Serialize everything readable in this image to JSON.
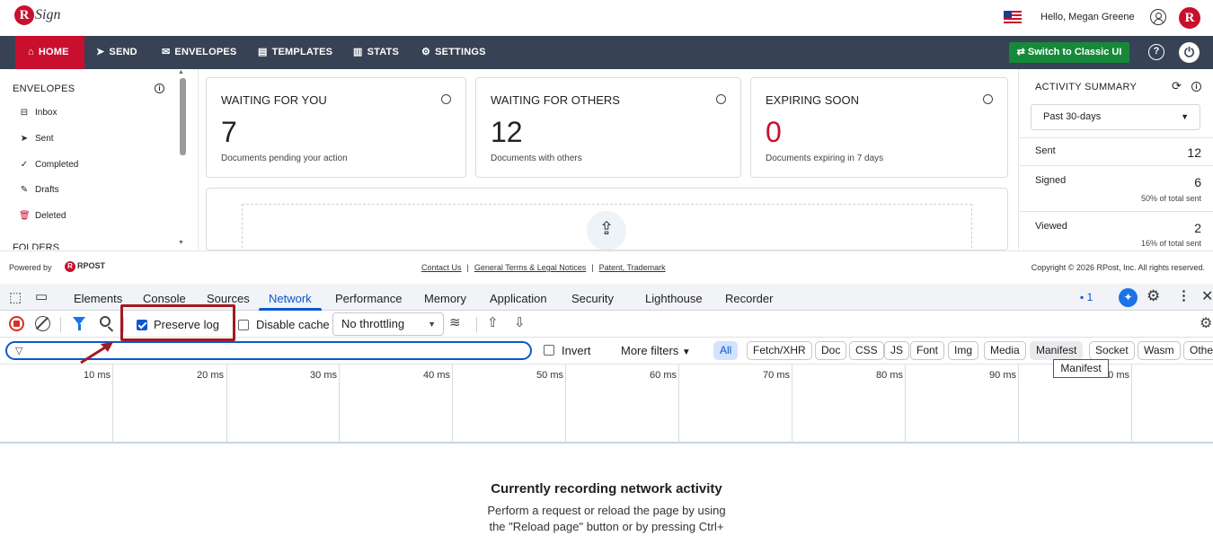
{
  "header": {
    "logo_letter": "R",
    "logo_text": "Sign",
    "greeting": "Hello, Megan Greene",
    "avatar_letter": "R"
  },
  "nav": {
    "items": [
      {
        "label": "HOME",
        "icon": "home-icon"
      },
      {
        "label": "SEND",
        "icon": "send-icon"
      },
      {
        "label": "ENVELOPES",
        "icon": "envelope-icon"
      },
      {
        "label": "TEMPLATES",
        "icon": "document-icon"
      },
      {
        "label": "STATS",
        "icon": "bar-chart-icon"
      },
      {
        "label": "SETTINGS",
        "icon": "gear-icon"
      }
    ],
    "classic_button": "Switch to Classic UI",
    "help": "?",
    "accent": "#c8102e",
    "bar_color": "#374355",
    "classic_color": "#17893a"
  },
  "sidebar": {
    "title": "ENVELOPES",
    "items": [
      {
        "label": "Inbox",
        "icon": "inbox-icon"
      },
      {
        "label": "Sent",
        "icon": "send-icon"
      },
      {
        "label": "Completed",
        "icon": "check-circle-icon"
      },
      {
        "label": "Drafts",
        "icon": "edit-icon"
      },
      {
        "label": "Deleted",
        "icon": "trash-icon"
      }
    ],
    "folders_title": "FOLDERS"
  },
  "cards": [
    {
      "title": "WAITING FOR YOU",
      "count": "7",
      "desc": "Documents pending your action"
    },
    {
      "title": "WAITING FOR OTHERS",
      "count": "12",
      "desc": "Documents with others"
    },
    {
      "title": "EXPIRING SOON",
      "count": "0",
      "desc": "Documents expiring in 7 days"
    }
  ],
  "activity": {
    "title": "ACTIVITY SUMMARY",
    "period": "Past 30-days",
    "stats": [
      {
        "label": "Sent",
        "value": "12",
        "pct": ""
      },
      {
        "label": "Signed",
        "value": "6",
        "pct": "50% of total sent"
      },
      {
        "label": "Viewed",
        "value": "2",
        "pct": "16% of total sent"
      }
    ]
  },
  "footer": {
    "powered": "Powered by",
    "brand": "RPOST",
    "links": [
      "Contact Us",
      "General Terms & Legal Notices",
      "Patent, Trademark"
    ],
    "separator": "|",
    "copyright": "Copyright © 2026 RPost, Inc. All rights reserved."
  },
  "devtools": {
    "tabs": [
      "Elements",
      "Console",
      "Sources",
      "Network",
      "Performance",
      "Memory",
      "Application",
      "Security",
      "Lighthouse",
      "Recorder"
    ],
    "active_tab": "Network",
    "message_count": "1",
    "preserve_log": "Preserve log",
    "disable_cache": "Disable cache",
    "throttling": "No throttling",
    "invert": "Invert",
    "more_filters": "More filters",
    "chips": [
      "All",
      "Fetch/XHR",
      "Doc",
      "CSS",
      "JS",
      "Font",
      "Img",
      "Media",
      "Manifest",
      "Socket",
      "Wasm",
      "Other"
    ],
    "tooltip": "Manifest",
    "timeline_labels": [
      "10 ms",
      "20 ms",
      "30 ms",
      "40 ms",
      "50 ms",
      "60 ms",
      "70 ms",
      "80 ms",
      "90 ms",
      "0 ms"
    ],
    "recording_title": "Currently recording network activity",
    "recording_line1": "Perform a request or reload the page by using",
    "recording_line2": "the \"Reload page\" button or by pressing Ctrl+"
  }
}
